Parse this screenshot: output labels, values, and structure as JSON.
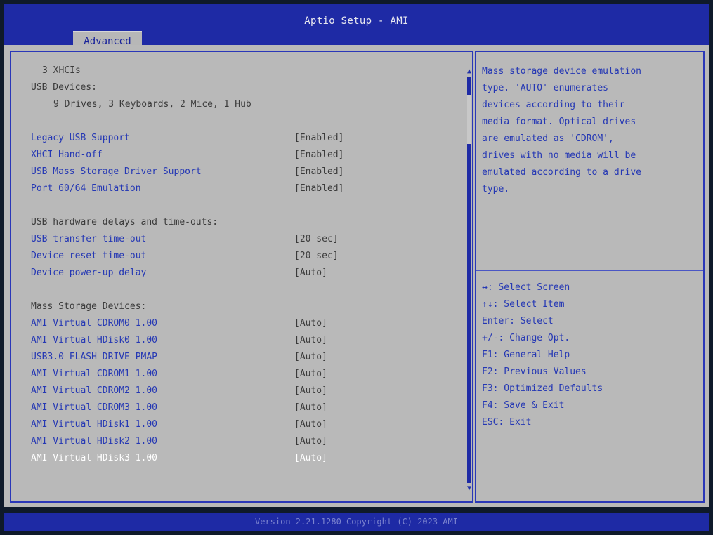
{
  "header": {
    "title": "Aptio Setup - AMI",
    "tab": "Advanced"
  },
  "info": [
    {
      "label": "3 XHCIs",
      "indent": 2
    },
    {
      "label": "USB Devices:",
      "indent": 0
    },
    {
      "label": "9 Drives, 3 Keyboards, 2 Mice, 1 Hub",
      "indent": 4
    }
  ],
  "settings": [
    {
      "label": "Legacy USB Support",
      "value": "[Enabled]"
    },
    {
      "label": "XHCI Hand-off",
      "value": "[Enabled]"
    },
    {
      "label": "USB Mass Storage Driver Support",
      "value": "[Enabled]"
    },
    {
      "label": "Port 60/64 Emulation",
      "value": "[Enabled]"
    }
  ],
  "delays_header": "USB hardware delays and time-outs:",
  "delays": [
    {
      "label": "USB transfer time-out",
      "value": "[20 sec]"
    },
    {
      "label": "Device reset time-out",
      "value": "[20 sec]"
    },
    {
      "label": "Device power-up delay",
      "value": "[Auto]"
    }
  ],
  "mass_header": "Mass Storage Devices:",
  "mass": [
    {
      "label": "AMI Virtual CDROM0 1.00",
      "value": "[Auto]"
    },
    {
      "label": "AMI Virtual HDisk0 1.00",
      "value": "[Auto]"
    },
    {
      "label": "USB3.0 FLASH DRIVE PMAP",
      "value": "[Auto]"
    },
    {
      "label": "AMI Virtual CDROM1 1.00",
      "value": "[Auto]"
    },
    {
      "label": "AMI Virtual CDROM2 1.00",
      "value": "[Auto]"
    },
    {
      "label": "AMI Virtual CDROM3 1.00",
      "value": "[Auto]"
    },
    {
      "label": "AMI Virtual HDisk1 1.00",
      "value": "[Auto]"
    },
    {
      "label": "AMI Virtual HDisk2 1.00",
      "value": "[Auto]"
    },
    {
      "label": "AMI Virtual HDisk3 1.00",
      "value": "[Auto]",
      "selected": true
    }
  ],
  "help_lines": [
    "Mass storage device emulation",
    "type. 'AUTO' enumerates",
    "devices according to their",
    "media format. Optical drives",
    "are emulated as 'CDROM',",
    "drives with no media will be",
    "emulated according to a drive",
    "type."
  ],
  "keys": [
    "↔: Select Screen",
    "↑↓: Select Item",
    "Enter: Select",
    "+/-: Change Opt.",
    "F1: General Help",
    "F2: Previous Values",
    "F3: Optimized Defaults",
    "F4: Save & Exit",
    "ESC: Exit"
  ],
  "footer": "Version 2.21.1280 Copyright (C) 2023 AMI",
  "colors": {
    "header_bg": "#1e2aa5",
    "panel_bg": "#b9b9b9",
    "option_text": "#2538b4",
    "static_text": "#3b3b3b",
    "selected_text": "#ffffff"
  },
  "scroll_position": 0.05
}
